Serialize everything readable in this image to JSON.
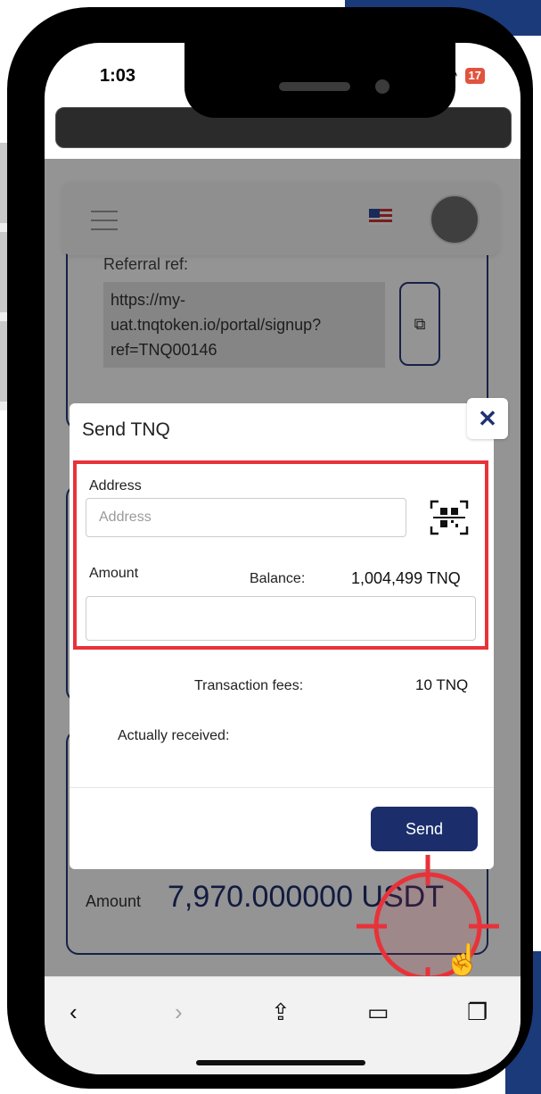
{
  "status_bar": {
    "time": "1:03",
    "battery": "17"
  },
  "referral": {
    "label": "Referral ref:",
    "link": "https://my-uat.tnqtoken.io/portal/signup?ref=TNQ00146"
  },
  "amount_card": {
    "label": "Amount",
    "value": "7,970.000000 USDT"
  },
  "modal": {
    "title": "Send TNQ",
    "close_label": "✕",
    "address_label": "Address",
    "address_placeholder": "Address",
    "amount_label": "Amount",
    "balance_label": "Balance:",
    "balance_value": "1,004,499 TNQ",
    "fees_label": "Transaction fees:",
    "fees_value": "10 TNQ",
    "received_label": "Actually received:",
    "send_label": "Send"
  },
  "toolbar": {
    "back": "‹",
    "forward": "›",
    "share": "⇪",
    "bookmarks": "▭",
    "tabs": "❐"
  },
  "colors": {
    "brand": "#1b2e6b",
    "highlight": "#e8323a"
  }
}
